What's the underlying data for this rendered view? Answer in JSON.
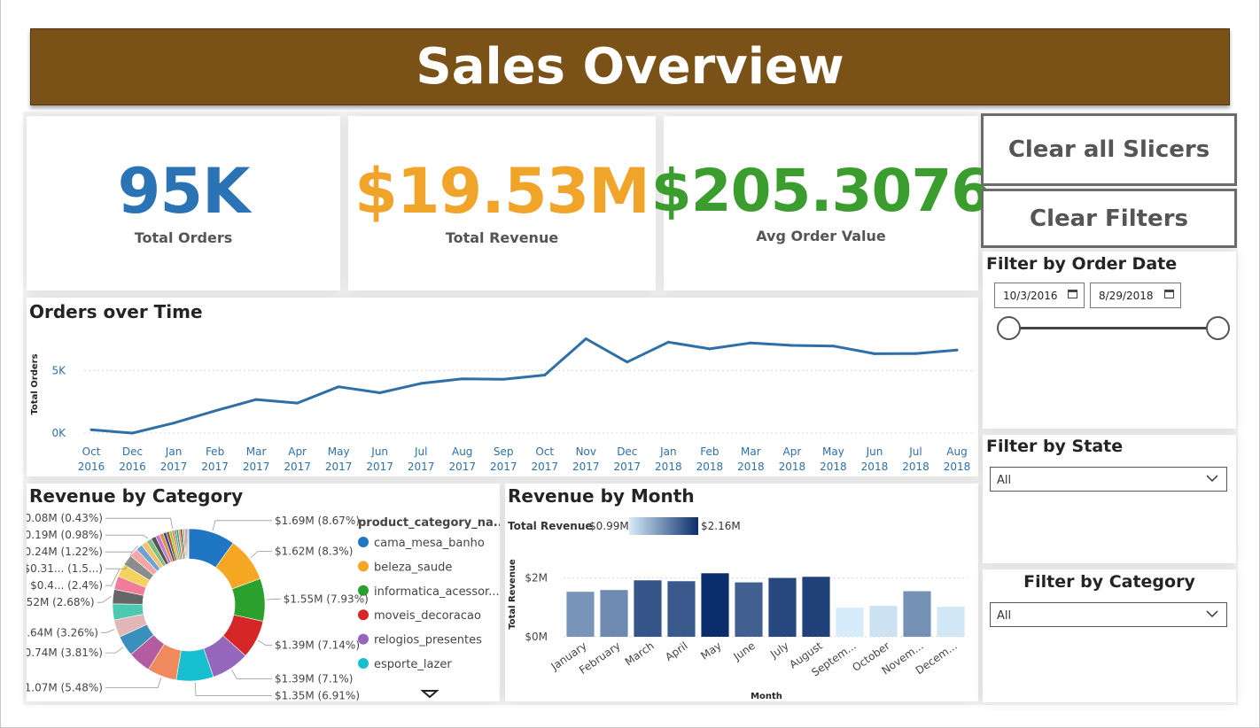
{
  "header": {
    "title": "Sales Overview"
  },
  "kpis": {
    "orders": {
      "value": "95K",
      "label": "Total Orders",
      "color": "#2a74b6"
    },
    "revenue": {
      "value": "$19.53M",
      "label": "Total Revenue",
      "color": "#f0a42a"
    },
    "aov": {
      "value": "$205.3076",
      "label": "Avg Order Value",
      "color": "#3a9d2e"
    }
  },
  "buttons": {
    "clear_slicers": "Clear all Slicers",
    "clear_filters": "Clear Filters"
  },
  "filters": {
    "date": {
      "title": "Filter by Order Date",
      "start": "10/3/2016",
      "end": "8/29/2018",
      "range_fraction": [
        0,
        1
      ]
    },
    "state": {
      "title": "Filter by State",
      "value": "All"
    },
    "category": {
      "title": "Filter by Category",
      "value": "All"
    }
  },
  "colors": {
    "banner": "#7a5218",
    "line": "#2e6fa7",
    "axis_text": "#2e6fa7"
  },
  "chart_data": [
    {
      "id": "orders_over_time",
      "type": "line",
      "title": "Orders over Time",
      "ylabel": "Total Orders",
      "x": [
        [
          "Oct",
          "2016"
        ],
        [
          "Dec",
          "2016"
        ],
        [
          "Jan",
          "2017"
        ],
        [
          "Feb",
          "2017"
        ],
        [
          "Mar",
          "2017"
        ],
        [
          "Apr",
          "2017"
        ],
        [
          "May",
          "2017"
        ],
        [
          "Jun",
          "2017"
        ],
        [
          "Jul",
          "2017"
        ],
        [
          "Aug",
          "2017"
        ],
        [
          "Sep",
          "2017"
        ],
        [
          "Oct",
          "2017"
        ],
        [
          "Nov",
          "2017"
        ],
        [
          "Dec",
          "2017"
        ],
        [
          "Jan",
          "2018"
        ],
        [
          "Feb",
          "2018"
        ],
        [
          "Mar",
          "2018"
        ],
        [
          "Apr",
          "2018"
        ],
        [
          "May",
          "2018"
        ],
        [
          "Jun",
          "2018"
        ],
        [
          "Jul",
          "2018"
        ],
        [
          "Aug",
          "2018"
        ]
      ],
      "values": [
        265,
        1,
        800,
        1780,
        2680,
        2400,
        3700,
        3220,
        3970,
        4330,
        4300,
        4640,
        7540,
        5680,
        7270,
        6730,
        7210,
        7010,
        6960,
        6340,
        6360,
        6640
      ],
      "ylim": [
        0,
        8000
      ],
      "yticks": [
        0,
        5000
      ],
      "ytick_labels": [
        "0K",
        "5K"
      ],
      "grid": true
    },
    {
      "id": "revenue_by_category",
      "type": "pie",
      "title": "Revenue by Category",
      "legend_title": "product_category_na...",
      "legend": [
        {
          "name": "cama_mesa_banho",
          "color": "#1f77c4"
        },
        {
          "name": "beleza_saude",
          "color": "#f5a623"
        },
        {
          "name": "informatica_acessor...",
          "color": "#2ca02c"
        },
        {
          "name": "moveis_decoracao",
          "color": "#d62728"
        },
        {
          "name": "relogios_presentes",
          "color": "#9467bd"
        },
        {
          "name": "esporte_lazer",
          "color": "#17becf"
        }
      ],
      "slices": [
        {
          "value": 8.67,
          "label": "$1.69M (8.67%)",
          "color": "#1f77c4"
        },
        {
          "value": 8.3,
          "label": "$1.62M (8.3%)",
          "color": "#f5a623"
        },
        {
          "value": 7.93,
          "label": "$1.55M (7.93%)",
          "color": "#2ca02c"
        },
        {
          "value": 7.14,
          "label": "$1.39M (7.14%)",
          "color": "#d62728"
        },
        {
          "value": 7.1,
          "label": "$1.39M (7.1%)",
          "color": "#9467bd"
        },
        {
          "value": 6.91,
          "label": "$1.35M (6.91%)",
          "color": "#17becf"
        },
        {
          "value": 5.48,
          "label": "$1.07M (5.48%)",
          "color": "#f08a5d"
        },
        {
          "value": 4.2,
          "label": "",
          "color": "#b35ca0"
        },
        {
          "value": 3.81,
          "label": "$0.74M (3.81%)",
          "color": "#3b8fbd"
        },
        {
          "value": 3.26,
          "label": "$0.64M (3.26%)",
          "color": "#e2b6b6"
        },
        {
          "value": 3.0,
          "label": "",
          "color": "#4cc9b0"
        },
        {
          "value": 2.68,
          "label": "$0.52M (2.68%)",
          "color": "#666666"
        },
        {
          "value": 2.5,
          "label": "",
          "color": "#f07c9a"
        },
        {
          "value": 2.4,
          "label": "$0.4... (2.4%)",
          "color": "#f3d35b"
        },
        {
          "value": 2.0,
          "label": "",
          "color": "#8c8c8c"
        },
        {
          "value": 1.6,
          "label": "$0.31... (1.5...)",
          "color": "#f4a6a6"
        },
        {
          "value": 1.22,
          "label": "$0.24M (1.22%)",
          "color": "#6aa4d6"
        },
        {
          "value": 1.1,
          "label": "",
          "color": "#f7c26b"
        },
        {
          "value": 0.98,
          "label": "$0.19M (0.98%)",
          "color": "#7fbf7f"
        },
        {
          "value": 0.9,
          "label": "",
          "color": "#555555"
        },
        {
          "value": 0.8,
          "label": "",
          "color": "#c27bd1"
        },
        {
          "value": 0.7,
          "label": "",
          "color": "#e88a3a"
        },
        {
          "value": 0.6,
          "label": "",
          "color": "#2f4f8f"
        },
        {
          "value": 0.55,
          "label": "",
          "color": "#a0522d"
        },
        {
          "value": 0.5,
          "label": "",
          "color": "#9acd32"
        },
        {
          "value": 0.43,
          "label": "$0.08M (0.43%)",
          "color": "#ff6f61"
        },
        {
          "value": 0.4,
          "label": "",
          "color": "#3cb371"
        },
        {
          "value": 0.38,
          "label": "",
          "color": "#4682b4"
        },
        {
          "value": 0.35,
          "label": "",
          "color": "#daa520"
        },
        {
          "value": 0.3,
          "label": "",
          "color": "#8b0000"
        },
        {
          "value": 0.28,
          "label": "",
          "color": "#20b2aa"
        },
        {
          "value": 0.25,
          "label": "",
          "color": "#ff8c00"
        },
        {
          "value": 0.22,
          "label": "",
          "color": "#6a5acd"
        },
        {
          "value": 0.2,
          "label": "",
          "color": "#c71585"
        },
        {
          "value": 0.18,
          "label": "",
          "color": "#2e8b57"
        },
        {
          "value": 0.15,
          "label": "",
          "color": "#d2691e"
        }
      ]
    },
    {
      "id": "revenue_by_month",
      "type": "bar",
      "title": "Revenue by Month",
      "xlabel": "Month",
      "ylabel": "Total Revenue",
      "legend_label": "Total Revenue",
      "gradient_min_label": "$0.99M",
      "gradient_max_label": "$2.16M",
      "gradient_colors": [
        "#d6ecfa",
        "#0b2d6b"
      ],
      "categories": [
        "January",
        "February",
        "March",
        "April",
        "May",
        "June",
        "July",
        "August",
        "Septem...",
        "October",
        "Novem...",
        "Decem..."
      ],
      "values": [
        1.53,
        1.59,
        1.92,
        1.89,
        2.16,
        1.85,
        2.0,
        2.04,
        0.99,
        1.05,
        1.55,
        1.02
      ],
      "ylim": [
        0,
        2.5
      ],
      "yticks": [
        0,
        2
      ],
      "ytick_labels": [
        "$0M",
        "$2M"
      ],
      "grid": true
    }
  ]
}
